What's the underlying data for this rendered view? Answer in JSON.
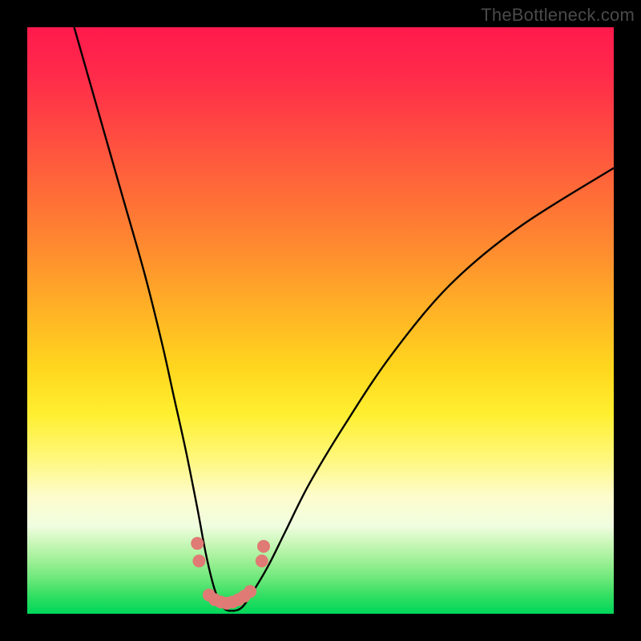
{
  "watermark": "TheBottleneck.com",
  "chart_data": {
    "type": "line",
    "title": "",
    "xlabel": "",
    "ylabel": "",
    "xlim": [
      0,
      100
    ],
    "ylim": [
      0,
      100
    ],
    "grid": false,
    "background_gradient": {
      "top": "#ff1a4d",
      "middle": "#ffe12a",
      "bottom": "#00d65a"
    },
    "series": [
      {
        "name": "curve",
        "color": "#000000",
        "x": [
          8,
          12,
          16,
          20,
          23,
          25,
          27,
          29,
          30.5,
          32,
          33.5,
          35,
          36.5,
          38,
          41,
          44,
          48,
          54,
          62,
          72,
          84,
          100
        ],
        "y": [
          100,
          86,
          72,
          58,
          46,
          37,
          28,
          18,
          10,
          4,
          1,
          0.5,
          1,
          3,
          8,
          14,
          22,
          32,
          44,
          56,
          66,
          76
        ]
      }
    ],
    "markers": {
      "name": "trough-markers",
      "color": "#e07a74",
      "points": [
        {
          "x": 29.0,
          "y": 12.0
        },
        {
          "x": 29.3,
          "y": 9.0
        },
        {
          "x": 31.0,
          "y": 3.2
        },
        {
          "x": 32.0,
          "y": 2.4
        },
        {
          "x": 33.0,
          "y": 2.0
        },
        {
          "x": 34.0,
          "y": 1.8
        },
        {
          "x": 35.0,
          "y": 2.0
        },
        {
          "x": 36.0,
          "y": 2.4
        },
        {
          "x": 37.0,
          "y": 3.0
        },
        {
          "x": 38.0,
          "y": 3.8
        },
        {
          "x": 40.0,
          "y": 9.0
        },
        {
          "x": 40.3,
          "y": 11.5
        }
      ],
      "radius": 8
    }
  }
}
